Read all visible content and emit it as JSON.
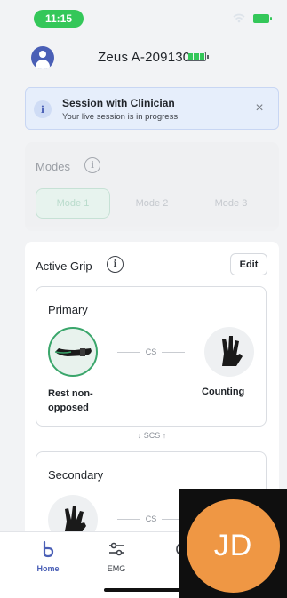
{
  "status_bar": {
    "time": "11:15"
  },
  "header": {
    "device_name": "Zeus A-209130"
  },
  "session_banner": {
    "title": "Session with Clinician",
    "subtitle": "Your live session is in progress",
    "close_symbol": "×"
  },
  "modes": {
    "label": "Modes",
    "tabs": [
      "Mode 1",
      "Mode 2",
      "Mode 3"
    ],
    "selected": "Mode 1"
  },
  "active_grip": {
    "title": "Active Grip",
    "edit_label": "Edit",
    "primary": {
      "title": "Primary",
      "left_grip": "Rest non-opposed",
      "right_grip": "Counting",
      "connector_label": "CS"
    },
    "switch_label": "SCS",
    "secondary": {
      "title": "Secondary",
      "connector_label": "CS"
    }
  },
  "bottom_nav": {
    "items": [
      {
        "label": "Home",
        "icon": "home-icon",
        "active": true
      },
      {
        "label": "EMG",
        "icon": "emg-sliders-icon",
        "active": false
      },
      {
        "label": "Su",
        "icon": "support-icon",
        "active": false
      }
    ]
  },
  "video_tile": {
    "initials": "JD"
  },
  "colors": {
    "accent": "#4a5fb6",
    "success": "#34c759",
    "banner_bg": "#e6eefb",
    "tile_orange": "#ef9744"
  }
}
